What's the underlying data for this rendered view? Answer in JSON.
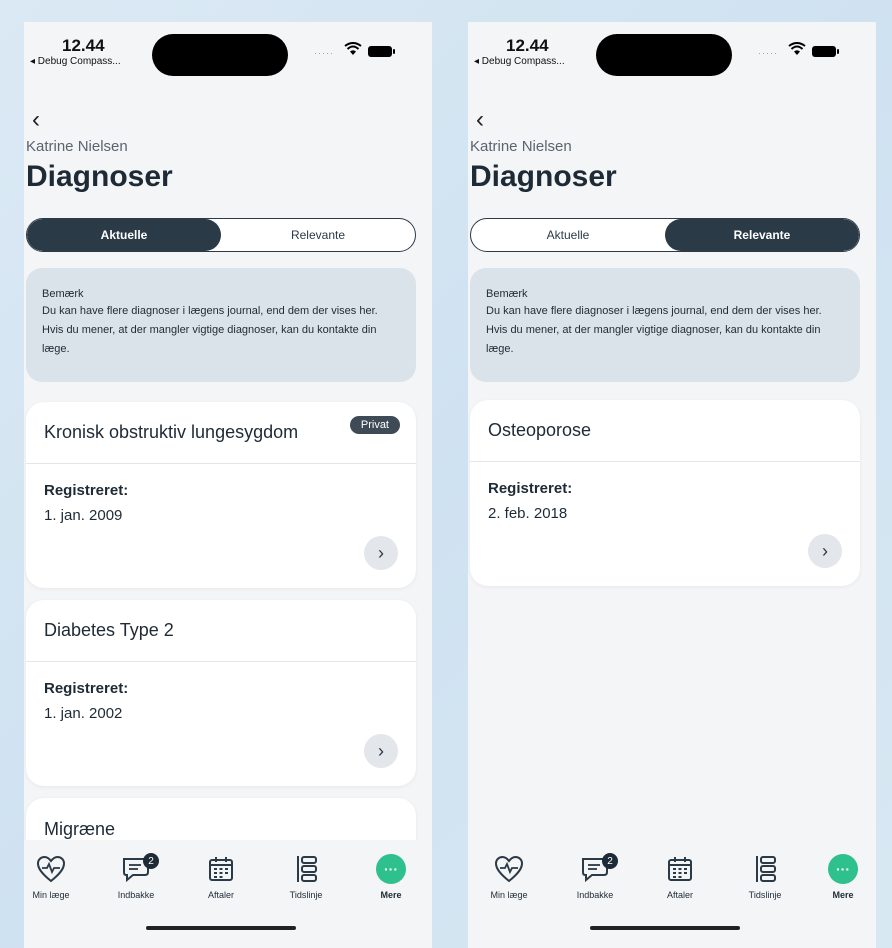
{
  "status": {
    "time": "12.44",
    "back_app": "◂ Debug Compass...",
    "signal": "·····"
  },
  "header": {
    "back": "‹",
    "person": "Katrine Nielsen",
    "title": "Diagnoser"
  },
  "segments": {
    "aktuelle": "Aktuelle",
    "relevante": "Relevante"
  },
  "note": {
    "title": "Bemærk",
    "body": "Du kan have flere diagnoser i lægens journal, end dem der vises her. Hvis du mener, at der mangler vigtige diagnoser, kan du kontakte din læge."
  },
  "left": {
    "cards": [
      {
        "title": "Kronisk obstruktiv lungesygdom",
        "badge": "Privat",
        "reg_label": "Registreret:",
        "date": "1. jan. 2009",
        "chev": "›"
      },
      {
        "title": "Diabetes Type 2",
        "reg_label": "Registreret:",
        "date": "1. jan. 2002",
        "chev": "›"
      },
      {
        "title": "Migræne"
      }
    ]
  },
  "right": {
    "cards": [
      {
        "title": "Osteoporose",
        "reg_label": "Registreret:",
        "date": "2. feb. 2018",
        "chev": "›"
      }
    ]
  },
  "tabbar": {
    "min_laege": "Min læge",
    "indbakke": "Indbakke",
    "indbakke_count": "2",
    "aftaler": "Aftaler",
    "tidslinje": "Tidslinje",
    "mere": "Mere",
    "mere_dots": "···"
  },
  "colors": {
    "accent": "#2ec08d",
    "dark": "#2b3a47",
    "note_bg": "#dbe3ea"
  }
}
